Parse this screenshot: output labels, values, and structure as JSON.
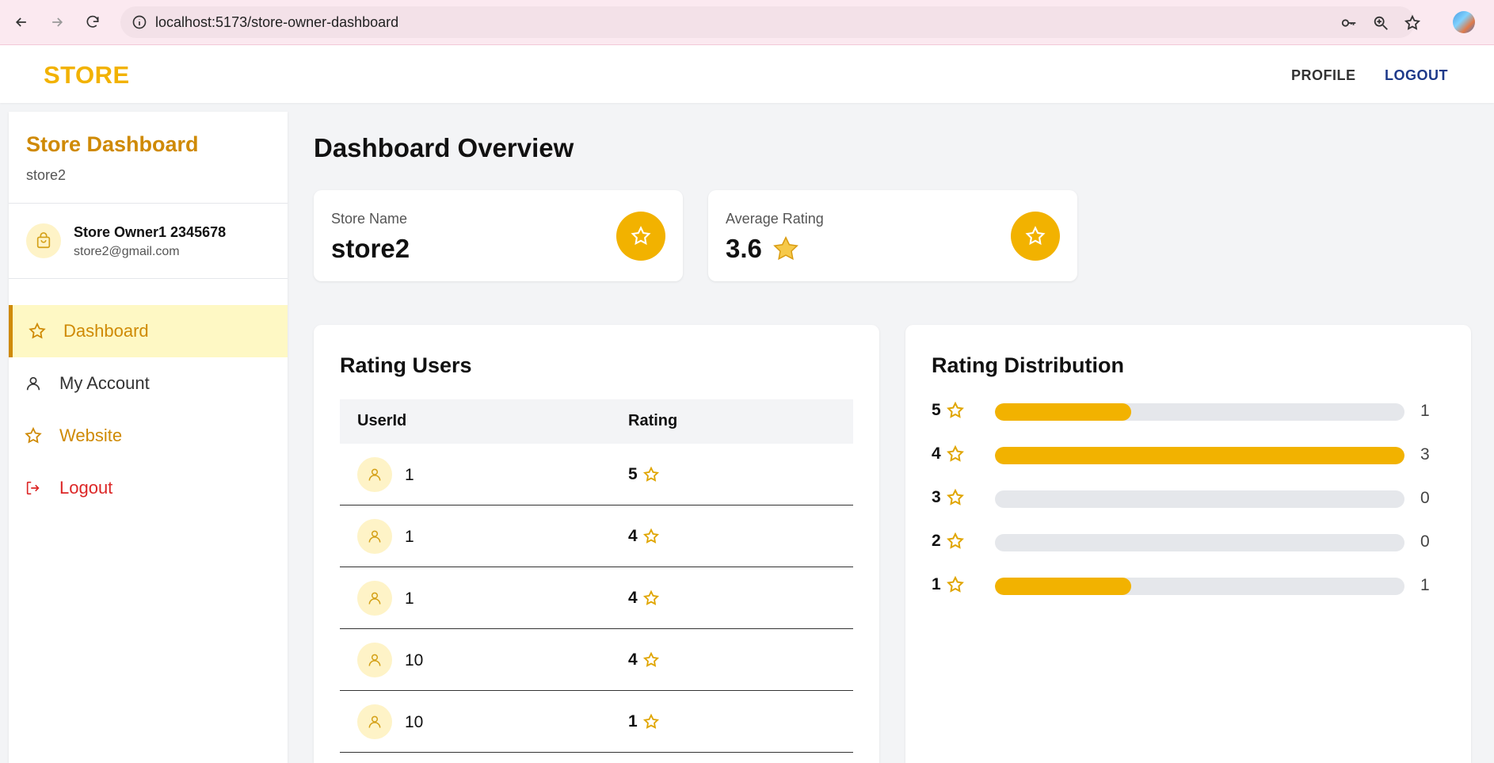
{
  "browser": {
    "url": "localhost:5173/store-owner-dashboard"
  },
  "appbar": {
    "brand": "STORE",
    "profile_label": "PROFILE",
    "logout_label": "LOGOUT"
  },
  "sidebar": {
    "title": "Store Dashboard",
    "subtitle": "store2",
    "owner_name": "Store Owner1 2345678",
    "owner_email": "store2@gmail.com",
    "items": [
      {
        "label": "Dashboard",
        "icon": "star-icon",
        "active": true
      },
      {
        "label": "My Account",
        "icon": "user-icon"
      },
      {
        "label": "Website",
        "icon": "star-icon"
      },
      {
        "label": "Logout",
        "icon": "logout-icon"
      }
    ]
  },
  "main": {
    "title": "Dashboard Overview",
    "stats": [
      {
        "label": "Store Name",
        "value": "store2"
      },
      {
        "label": "Average Rating",
        "value": "3.6",
        "emoji": "⭐"
      }
    ]
  },
  "rating_users": {
    "title": "Rating Users",
    "columns": [
      "UserId",
      "Rating"
    ],
    "rows": [
      {
        "user_id": "1",
        "rating": "5"
      },
      {
        "user_id": "1",
        "rating": "4"
      },
      {
        "user_id": "1",
        "rating": "4"
      },
      {
        "user_id": "10",
        "rating": "4"
      },
      {
        "user_id": "10",
        "rating": "1"
      }
    ]
  },
  "distribution": {
    "title": "Rating Distribution",
    "rows": [
      {
        "stars": "5",
        "count": "1",
        "fraction": 0.333
      },
      {
        "stars": "4",
        "count": "3",
        "fraction": 1.0
      },
      {
        "stars": "3",
        "count": "0",
        "fraction": 0
      },
      {
        "stars": "2",
        "count": "0",
        "fraction": 0
      },
      {
        "stars": "1",
        "count": "1",
        "fraction": 0.333
      }
    ]
  },
  "colors": {
    "accent": "#f2b200",
    "accent_dark": "#cf8a05",
    "danger": "#dc2626",
    "logout_link": "#1e3a8a"
  }
}
